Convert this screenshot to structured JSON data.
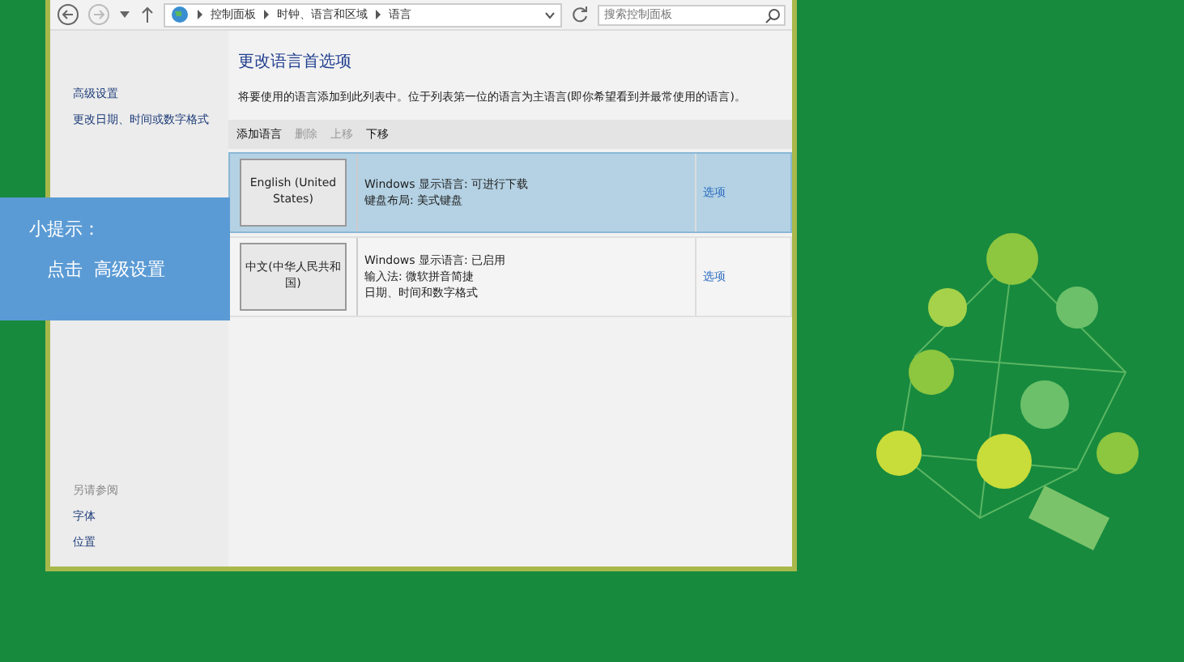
{
  "address_bar": {
    "breadcrumbs": [
      "控制面板",
      "时钟、语言和区域",
      "语言"
    ],
    "search": {
      "placeholder": "搜索控制面板"
    }
  },
  "sidebar": {
    "links": [
      "高级设置",
      "更改日期、时间或数字格式"
    ],
    "see_also": {
      "title": "另请参阅",
      "links": [
        "字体",
        "位置"
      ]
    }
  },
  "main": {
    "title": "更改语言首选项",
    "description": "将要使用的语言添加到此列表中。位于列表第一位的语言为主语言(即你希望看到并最常使用的语言)。",
    "toolbar": [
      {
        "label": "添加语言",
        "disabled": false
      },
      {
        "label": "删除",
        "disabled": true
      },
      {
        "label": "上移",
        "disabled": true
      },
      {
        "label": "下移",
        "disabled": false
      }
    ],
    "languages": [
      {
        "name": "English (United States)",
        "details": [
          "Windows 显示语言: 可进行下载",
          "键盘布局: 美式键盘"
        ],
        "options": "选项",
        "selected": true
      },
      {
        "name": "中文(中华人民共和国)",
        "details": [
          "Windows 显示语言: 已启用",
          "输入法: 微软拼音简捷",
          "日期、时间和数字格式"
        ],
        "options": "选项",
        "selected": false
      }
    ]
  },
  "tip": {
    "title": "小提示：",
    "text": "点击  高级设置"
  }
}
